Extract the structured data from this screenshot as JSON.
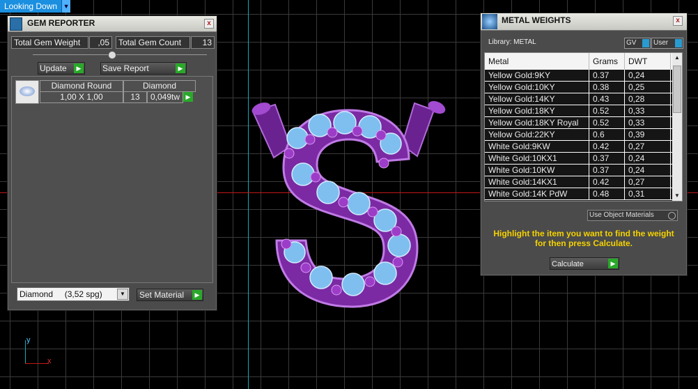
{
  "view_menu": {
    "label": "Looking Down",
    "arrow": "▼"
  },
  "gem_reporter": {
    "title": "GEM REPORTER",
    "total_weight_label": "Total Gem Weight",
    "total_weight_value": ",05",
    "total_count_label": "Total Gem Count",
    "total_count_value": "13",
    "update_label": "Update",
    "save_report_label": "Save Report",
    "gem_table": {
      "col1": "Diamond Round",
      "col2": "Diamond",
      "size": "1,00 X 1,00",
      "count": "13",
      "weight": "0,049tw"
    },
    "material_select": "Diamond     (3,52 spg)",
    "set_material_label": "Set Material",
    "close": "x"
  },
  "metal_weights": {
    "title": "METAL WEIGHTS",
    "library_label": "Library: METAL",
    "gv_label": "GV",
    "user_label": "User",
    "columns": [
      "Metal",
      "Grams",
      "DWT"
    ],
    "rows": [
      {
        "metal": "Yellow Gold:9KY",
        "grams": "0.37",
        "dwt": "0,24"
      },
      {
        "metal": "Yellow Gold:10KY",
        "grams": "0.38",
        "dwt": "0,25"
      },
      {
        "metal": "Yellow Gold:14KY",
        "grams": "0.43",
        "dwt": "0,28"
      },
      {
        "metal": "Yellow Gold:18KY",
        "grams": "0.52",
        "dwt": "0,33"
      },
      {
        "metal": "Yellow Gold:18KY Royal",
        "grams": "0.52",
        "dwt": "0,33"
      },
      {
        "metal": "Yellow Gold:22KY",
        "grams": "0.6",
        "dwt": "0,39"
      },
      {
        "metal": "White Gold:9KW",
        "grams": "0.42",
        "dwt": "0,27"
      },
      {
        "metal": "White Gold:10KX1",
        "grams": "0.37",
        "dwt": "0,24"
      },
      {
        "metal": "White Gold:10KW",
        "grams": "0.37",
        "dwt": "0,24"
      },
      {
        "metal": "White Gold:14KX1",
        "grams": "0.42",
        "dwt": "0,27"
      },
      {
        "metal": "White Gold:14K PdW",
        "grams": "0.48",
        "dwt": "0,31"
      }
    ],
    "use_object_materials_label": "Use Object Materials",
    "hint": "Highlight the item you want to find the weight for then press Calculate.",
    "calculate_label": "Calculate",
    "close": "x"
  },
  "axis_labels": {
    "y": "y",
    "x": "x"
  },
  "colors": {
    "accent_blue": "#1b8fe0",
    "go_green": "#29a829",
    "hint_yellow": "#f5d200",
    "ring_purple": "#8a2fb0",
    "grid_cyan": "#1aa7b6",
    "grid_red": "#c21818"
  }
}
